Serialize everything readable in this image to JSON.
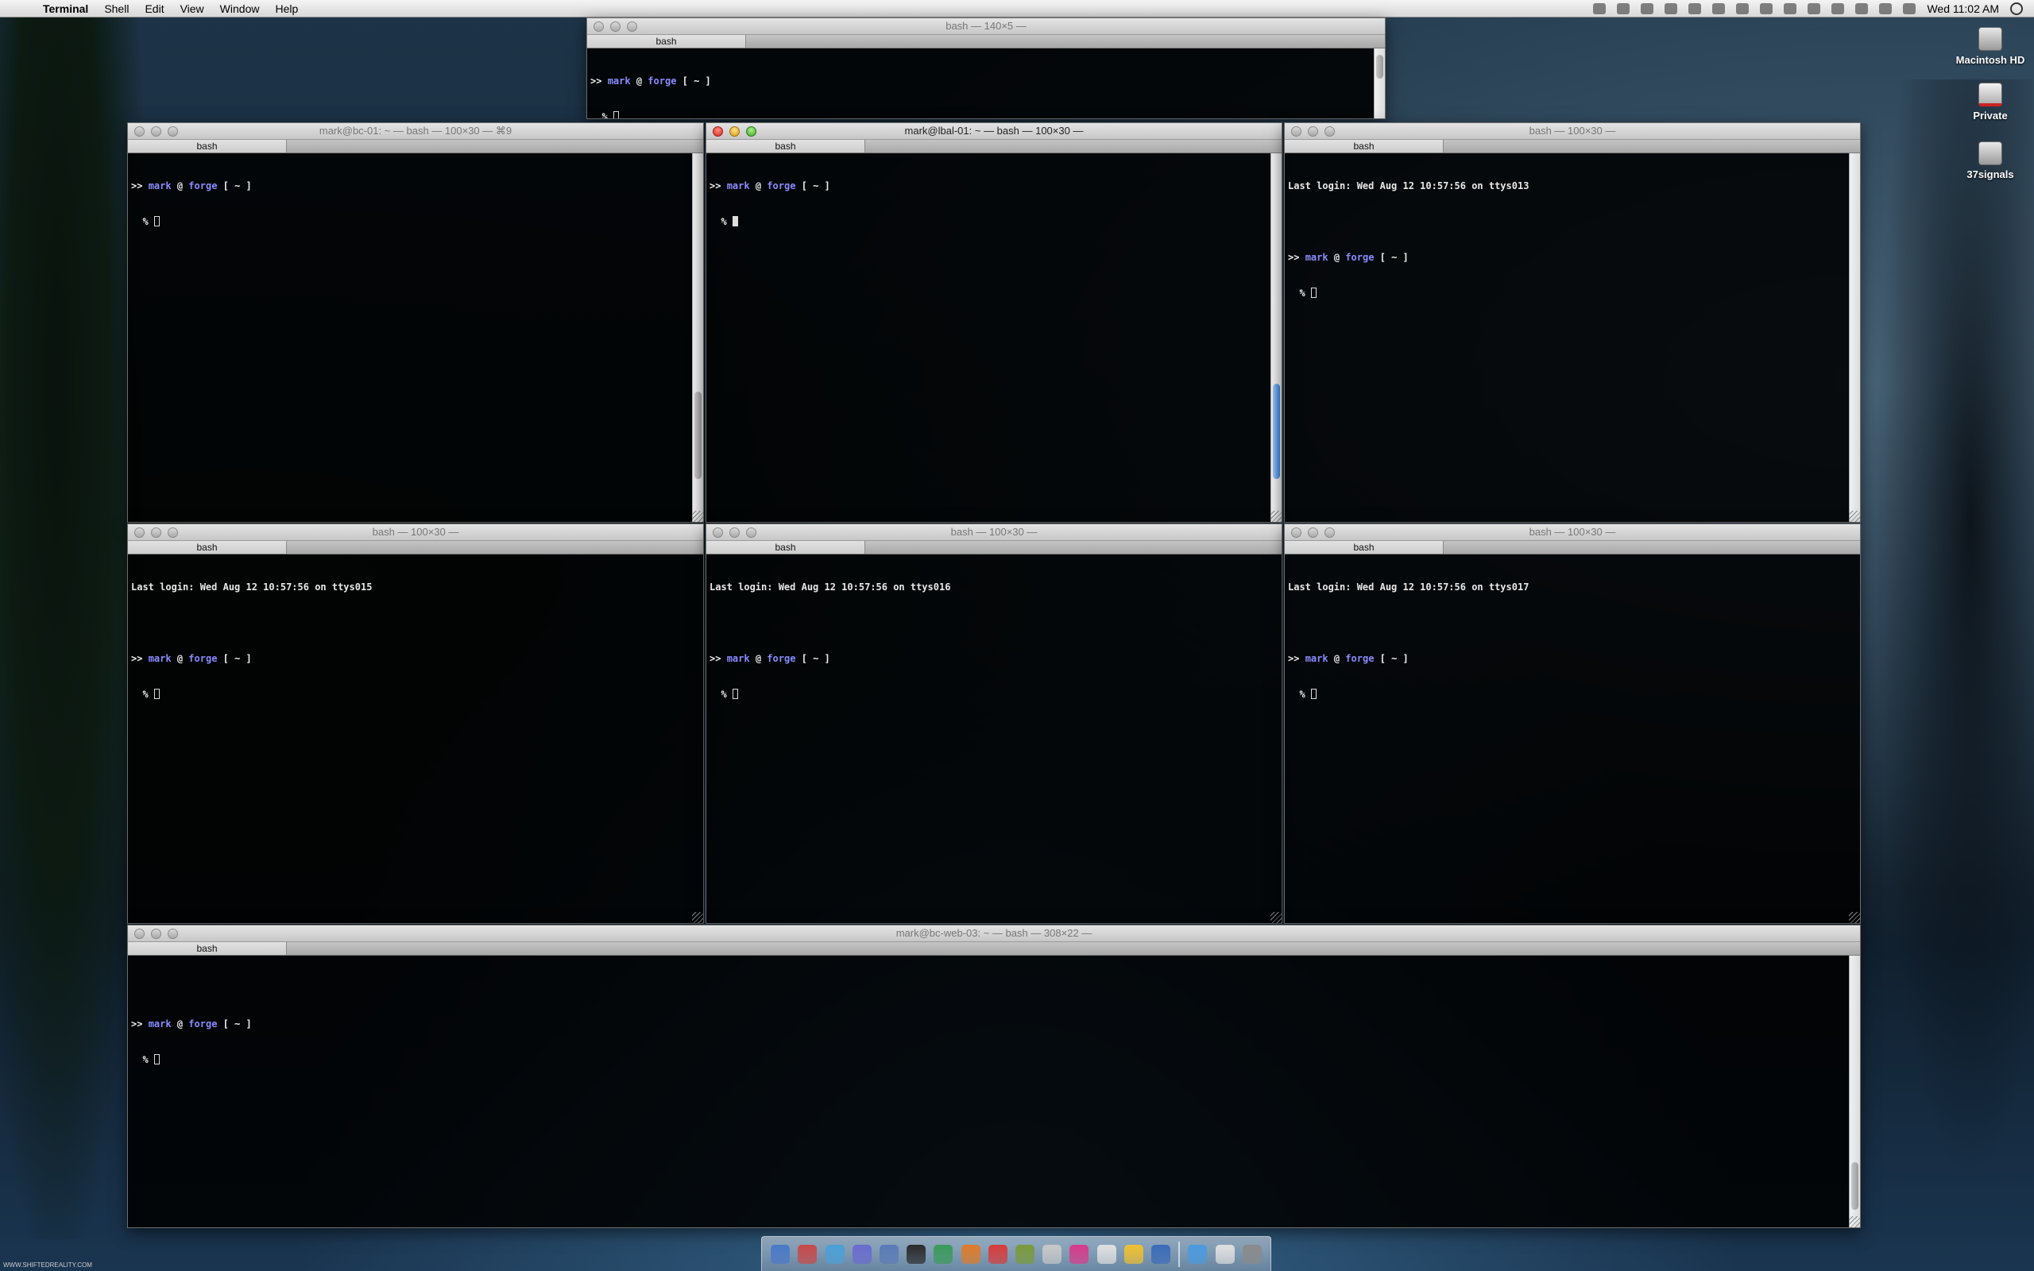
{
  "menubar": {
    "app_name": "Terminal",
    "items": [
      "Shell",
      "Edit",
      "View",
      "Window",
      "Help"
    ],
    "clock": "Wed 11:02 AM"
  },
  "desktop_icons": [
    "Macintosh HD",
    "Private",
    "37signals"
  ],
  "prompt": {
    "prefix": ">>",
    "user": "mark",
    "at": "@",
    "host": "forge",
    "path": "[ ~ ]",
    "ps2": "%"
  },
  "windows": {
    "top": {
      "title": "bash — 140×5 —",
      "tab": "bash"
    },
    "w1": {
      "title": "mark@bc-01: ~ — bash — 100×30 — ⌘9",
      "tab": "bash"
    },
    "w2": {
      "title": "mark@lbal-01: ~ — bash — 100×30 —",
      "tab": "bash"
    },
    "w3": {
      "title": "bash — 100×30 —",
      "tab": "bash",
      "login": "Last login: Wed Aug 12 10:57:56 on ttys013"
    },
    "w4": {
      "title": "bash — 100×30 —",
      "tab": "bash",
      "login": "Last login: Wed Aug 12 10:57:56 on ttys015"
    },
    "w5": {
      "title": "bash — 100×30 —",
      "tab": "bash",
      "login": "Last login: Wed Aug 12 10:57:56 on ttys016"
    },
    "w6": {
      "title": "bash — 100×30 —",
      "tab": "bash",
      "login": "Last login: Wed Aug 12 10:57:56 on ttys017"
    },
    "bottom": {
      "title": "mark@bc-web-03: ~ — bash — 308×22 —",
      "tab": "bash"
    }
  },
  "dock_colors": [
    "#4a78c8",
    "#c84848",
    "#4aa0d8",
    "#6a6ad0",
    "#5a7ab8",
    "#2a2a2a",
    "#3a9a5a",
    "#e07a28",
    "#d83a3a",
    "#7a9a3a",
    "#c8c8c8",
    "#d83a8a",
    "#e0e0e0",
    "#f0c030",
    "#3a6ab8",
    "#4a9ae0",
    "#e0e0e0",
    "#8a8a8a"
  ],
  "watermark": "WWW.SHIFTEDREALITY.COM"
}
